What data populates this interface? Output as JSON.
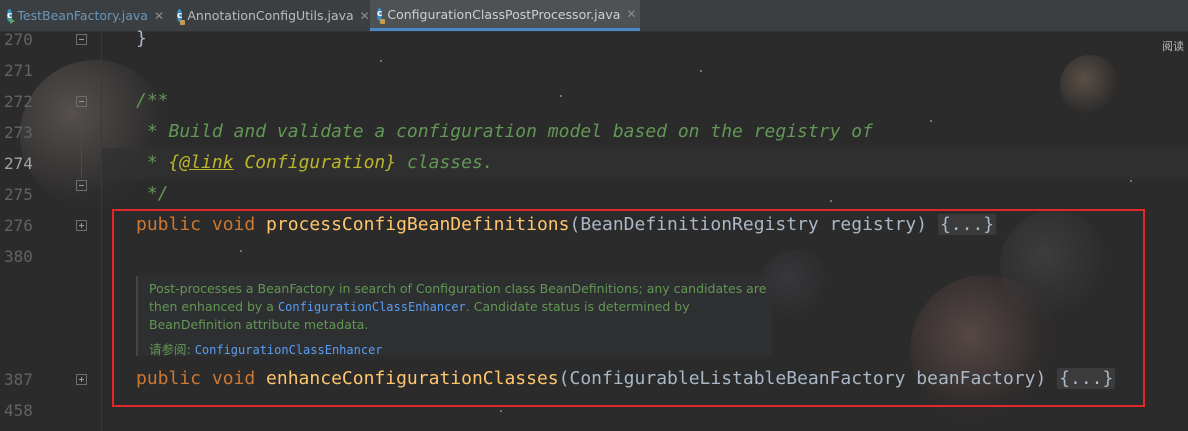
{
  "tabs": [
    {
      "label": "TestBeanFactory.java",
      "active": false,
      "icon": "java-class-run-icon"
    },
    {
      "label": "AnnotationConfigUtils.java",
      "active": false,
      "icon": "java-class-lock-icon"
    },
    {
      "label": "ConfigurationClassPostProcessor.java",
      "active": true,
      "icon": "java-class-lock-icon"
    }
  ],
  "reader_mode": "阅读",
  "line_numbers": [
    "270",
    "271",
    "272",
    "273",
    "274",
    "275",
    "276",
    "380",
    "387",
    "458"
  ],
  "current_line": "274",
  "code": {
    "line270": "}",
    "line272": "/**",
    "line273": " * Build and validate a configuration model based on the registry of",
    "line274_prefix": " * ",
    "line274_open_brace": "{",
    "line274_tag": "@link",
    "line274_ref": " Configuration",
    "line274_close_brace": "}",
    "line274_suffix": " classes.",
    "line275": " */",
    "line276": {
      "modifiers": "public void ",
      "method": "processConfigBeanDefinitions",
      "params": "(BeanDefinitionRegistry registry) ",
      "folded": "{...}"
    },
    "line387": {
      "modifiers": "public void ",
      "method": "enhanceConfigurationClasses",
      "params": "(ConfigurableListableBeanFactory beanFactory) ",
      "folded": "{...}"
    }
  },
  "doc": {
    "line1": "Post-processes a BeanFactory in search of Configuration class BeanDefinitions; any candidates are",
    "line2_prefix": "then enhanced by a ",
    "line2_link": "ConfigurationClassEnhancer",
    "line2_suffix": ". Candidate status is determined by",
    "line3": "BeanDefinition attribute metadata.",
    "see_label": "请参阅: ",
    "see_link": "ConfigurationClassEnhancer"
  },
  "colors": {
    "background": "#2b2b2b",
    "keyword": "#cc7832",
    "method": "#ffc66d",
    "comment": "#629755",
    "doc_tag": "#bbb529",
    "highlight_box": "#e0282c",
    "link": "#589df6"
  }
}
